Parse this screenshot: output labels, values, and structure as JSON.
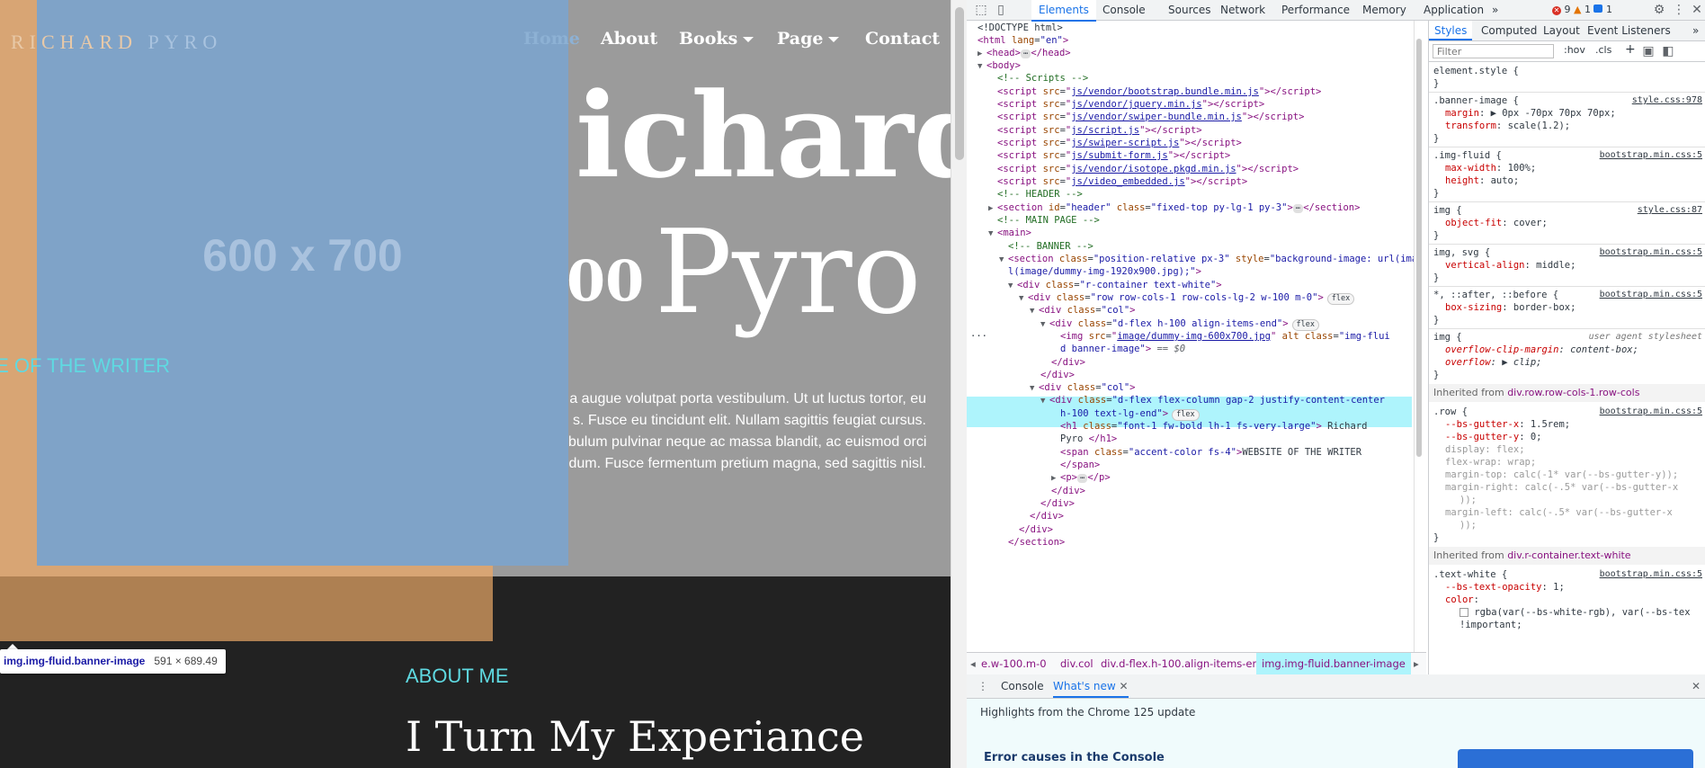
{
  "site": {
    "logo": {
      "part1": "RICHARD",
      "part2": "PYRO"
    },
    "nav": {
      "home": "Home",
      "about": "About",
      "books": "Books",
      "page": "Page",
      "contact": "Contact"
    },
    "placeholder_text": "600 x 700",
    "hero": {
      "title_line1": "ichard",
      "title_line2_fragment": "00",
      "title_line2": "Pyro",
      "tagline": "WEBSITE OF THE WRITER",
      "paragraph_lines": [
        "a augue volutpat porta vestibulum. Ut ut luctus tortor, eu",
        "s. Fusce eu tincidunt elit. Nullam sagittis feugiat cursus.",
        "bulum pulvinar neque ac massa blandit, ac euismod orci",
        "dum. Fusce fermentum pretium magna, sed sagittis nisl."
      ]
    },
    "about": {
      "label": "ABOUT ME",
      "title": "I Turn My Experiance"
    },
    "tooltip": {
      "selector": "img.img-fluid.banner-image",
      "size": "591 × 689.49"
    }
  },
  "devtools": {
    "tabs": [
      "Elements",
      "Console",
      "Sources",
      "Network",
      "Performance",
      "Memory",
      "Application"
    ],
    "more_tabs": "»",
    "counts": {
      "errors": "9",
      "warnings": "1",
      "info": "1"
    },
    "styles_tabs": [
      "Styles",
      "Computed",
      "Layout",
      "Event Listeners"
    ],
    "styles_more": "»",
    "filter_placeholder": "Filter",
    "filter_tools": {
      "hov": ":hov",
      "cls": ".cls",
      "plus": "+"
    },
    "breadcrumbs": [
      "e.w-100.m-0",
      "div.col",
      "div.d-flex.h-100.align-items-end",
      "img.img-fluid.banner-image"
    ],
    "drawer": {
      "tab1": "Console",
      "tab2": "What's new",
      "highlights": "Highlights from the Chrome 125 update",
      "headline": "Error causes in the Console"
    },
    "dom": {
      "doctype": "<!DOCTYPE html>",
      "html_open": "<html",
      "lang_attr": "lang",
      "lang_val": "\"en\"",
      "head": "<head>",
      "head_close": "</head>",
      "body": "<body>",
      "c_scripts": "<!-- Scripts -->",
      "scripts": [
        "js/vendor/bootstrap.bundle.min.js",
        "js/vendor/jquery.min.js",
        "js/vendor/swiper-bundle.min.js",
        "js/script.js",
        "js/swiper-script.js",
        "js/submit-form.js",
        "js/vendor/isotope.pkgd.min.js",
        "js/video_embedded.js"
      ],
      "c_header": "<!-- HEADER -->",
      "section_header_id": "\"header\"",
      "section_header_class": "\"fixed-top py-lg-1 py-3\"",
      "section_close": "</section>",
      "c_main": "<!-- MAIN PAGE -->",
      "main": "<main>",
      "c_banner": "<!-- BANNER -->",
      "banner_class": "\"position-relative px-3\"",
      "banner_style": "\"background-image: url(image/dummy-img-1920x900.jpg);\"",
      "rcontainer_class": "\"r-container text-white\"",
      "row_class": "\"row row-cols-1 row-cols-lg-2 w-100 m-0\"",
      "col_class": "\"col\"",
      "dflex_class": "\"d-flex h-100 align-items-end\"",
      "img_src": "image/dummy-img-600x700.jpg",
      "img_class_1": "\"img-flui",
      "img_class_2": "d banner-image\"",
      "eq0": "== $0",
      "col2_class_1": "\"d-flex flex-column gap-2 justify-content-center",
      "col2_class_2": "h-100 text-lg-end\"",
      "h1_class": "\"font-1 fw-bold lh-1 fs-very-large\"",
      "h1_text_1": "Richard",
      "h1_text_2": "Pyro ",
      "span_class": "\"accent-color fs-4\"",
      "span_text": "WEBSITE OF THE WRITER",
      "flex_pill": "flex",
      "grid_pill": "flex"
    },
    "rules": {
      "element_style": "element.style {",
      "banner": {
        "sel": ".banner-image {",
        "src": "style.css:978",
        "margin": "0px -70px 70px 70px;",
        "transform": "scale(1.2);"
      },
      "imgfluid": {
        "sel": ".img-fluid {",
        "src": "bootstrap.min.css:5",
        "maxw": "100%;",
        "h": "auto;"
      },
      "img_obj": {
        "sel": "img {",
        "src": "style.css:87",
        "fit": "cover;"
      },
      "img_svg": {
        "sel": "img, svg {",
        "src": "bootstrap.min.css:5",
        "va": "middle;"
      },
      "boxsize": {
        "sel": "*, ::after, ::before {",
        "src": "bootstrap.min.css:5",
        "bs": "border-box;"
      },
      "img_ua": {
        "sel": "img {",
        "src": "user agent stylesheet",
        "ocm": "content-box;",
        "ov": "clip;"
      },
      "inh1": {
        "label": "Inherited from",
        "el": "div.row.row-cols-1.row-cols"
      },
      "row": {
        "sel": ".row {",
        "src": "bootstrap.min.css:5",
        "gx": "1.5rem;",
        "gy": "0;",
        "disp": "flex;",
        "wrap": "wrap;",
        "mt": "calc(-1* var(--bs-gutter-y));",
        "mr": "calc(-.5* var(--bs-gutter-x",
        "mr2": "));",
        "ml": "calc(-.5* var(--bs-gutter-x",
        "ml2": "));"
      },
      "inh2": {
        "label": "Inherited from",
        "el": "div.r-container.text-white"
      },
      "textwhite": {
        "sel": ".text-white {",
        "src": "bootstrap.min.css:5",
        "op": "1;",
        "color1": "rgba(var(--bs-white-rgb), var(--bs-tex",
        "color2": "!important;"
      }
    }
  }
}
